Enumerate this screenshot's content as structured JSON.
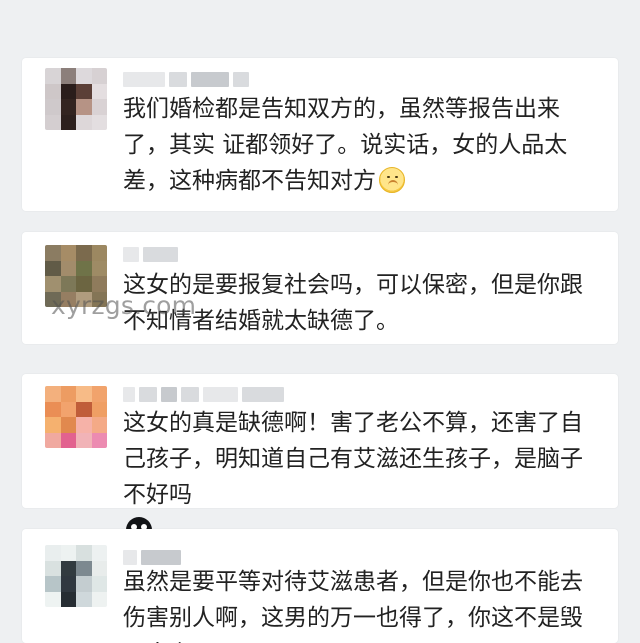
{
  "comments": [
    {
      "text": "我们婚检都是告知双方的，虽然等报告出来了，其实 证都领好了。说实话，女的人品太差，这种病都不告知对方",
      "emoji": "hushed-face-icon"
    },
    {
      "text": "这女的是要报复社会吗，可以保密，但是你跟不知情者结婚就太缺德了。",
      "emoji": ""
    },
    {
      "text": "这女的真是缺德啊！害了老公不算，还害了自己孩子，明知道自己有艾滋还生孩子，是脑子不好吗",
      "emoji": "shocked-face-icon"
    },
    {
      "text": "虽然是要平等对待艾滋患者，但是你也不能去伤害别人啊，这男的万一也得了，你这不是毁了人么",
      "emoji": ""
    }
  ],
  "watermark": "xyrzgs.com",
  "colors": {
    "background": "#eef0f2",
    "card": "#ffffff",
    "text": "#222222",
    "watermark": "rgba(80, 80, 80, 0.55)"
  }
}
